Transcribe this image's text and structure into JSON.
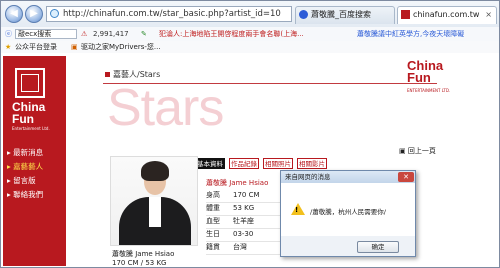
{
  "browser": {
    "url": "http://chinafun.com.tw/star_basic.php?artist_id=10",
    "tabs": [
      {
        "title": "蕭敬騰_百度搜索",
        "active": false
      },
      {
        "title": "chinafun.com.tw",
        "active": true
      }
    ],
    "tab_close": "×",
    "toolbar": {
      "search_text": "敲ecx搜索",
      "counter": "2,991,417",
      "news1": "犯淪人:上海地陷王開啓程度兩手會名聯(上海...",
      "news2": "蕭敬騰議中紅英學方,今夜天壞障礙"
    },
    "favorites": {
      "item1": "公众平台登录",
      "item2": "驱动之家MyDrivers-您..."
    }
  },
  "site": {
    "logo_text_1": "China",
    "logo_text_2": "Fun",
    "logo_sub": "Entertainment Ltd.",
    "menu": [
      {
        "label": "最新消息",
        "active": false
      },
      {
        "label": "嘉藝藝人",
        "active": true
      },
      {
        "label": "留言版",
        "active": false
      },
      {
        "label": "聯絡我們",
        "active": false
      }
    ],
    "breadcrumb": "嘉藝人/Stars",
    "stars_watermark": "Stars",
    "corner_logo_1": "China",
    "corner_logo_2": "Fun",
    "corner_logo_sub": "ENTERTAINMENT LTD.",
    "profile_tabs": [
      "基本資料",
      "作品紀錄",
      "相關照片",
      "相關影片"
    ],
    "back_link": "回上一頁",
    "artist_name": "蕭敬騰 Jame Hsiao",
    "info": [
      {
        "key": "身高",
        "value": "170 CM"
      },
      {
        "key": "體重",
        "value": "53 KG"
      },
      {
        "key": "血型",
        "value": "牡羊座"
      },
      {
        "key": "生日",
        "value": "03-30"
      },
      {
        "key": "籍貫",
        "value": "台灣"
      }
    ],
    "photo_caption_1": "蕭敬騰 Jame Hsiao",
    "photo_caption_2": "170 CM / 53 KG"
  },
  "dialog": {
    "title": "来自网页的消息",
    "message": "/蕭敬騰，杭州人民需要你/",
    "ok_label": "确定",
    "close_label": "✕"
  }
}
